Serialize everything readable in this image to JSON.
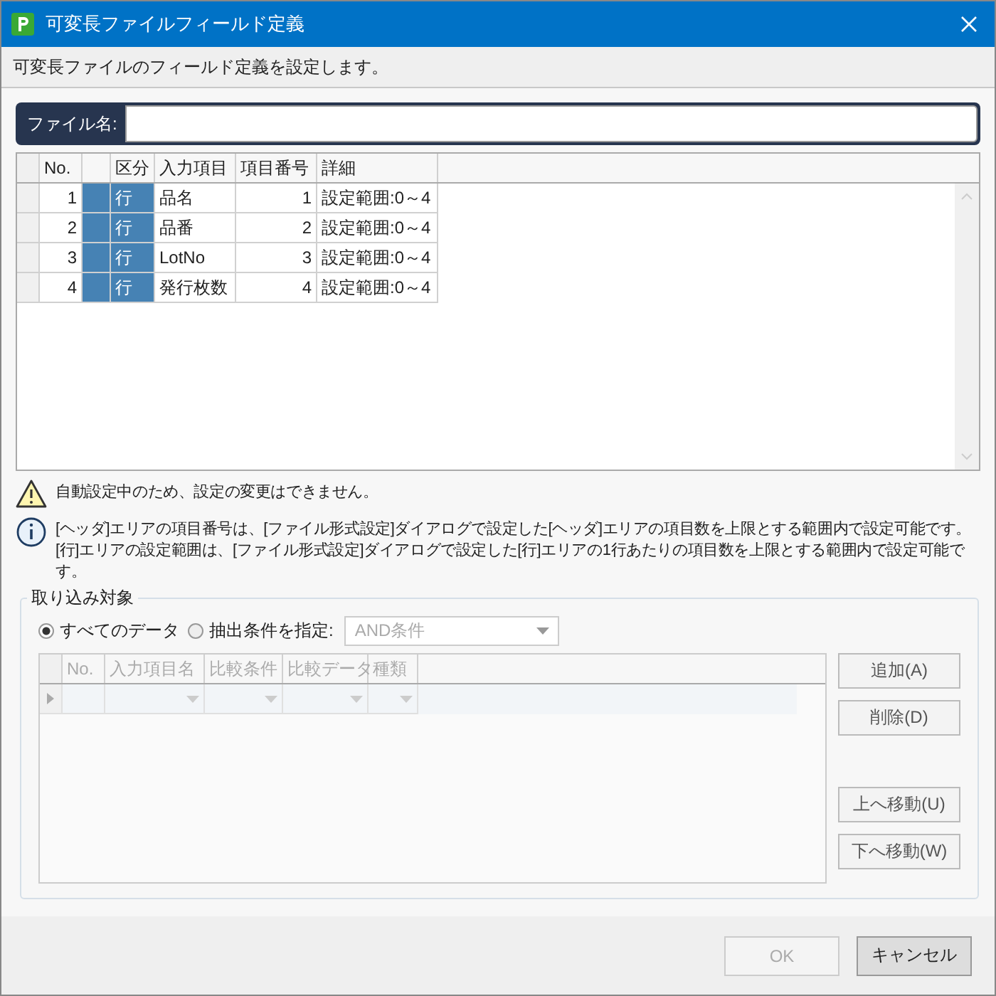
{
  "window": {
    "title": "可変長ファイルフィールド定義"
  },
  "description": "可変長ファイルのフィールド定義を設定します。",
  "file_name": {
    "label": "ファイル名:"
  },
  "fields_table": {
    "columns": [
      "No.",
      "区分",
      "入力項目",
      "項目番号",
      "詳細"
    ],
    "rows": [
      {
        "no": "1",
        "category": "行",
        "item": "品名",
        "item_number": "1",
        "detail": "設定範囲:0～4"
      },
      {
        "no": "2",
        "category": "行",
        "item": "品番",
        "item_number": "2",
        "detail": "設定範囲:0～4"
      },
      {
        "no": "3",
        "category": "行",
        "item": "LotNo",
        "item_number": "3",
        "detail": "設定範囲:0～4"
      },
      {
        "no": "4",
        "category": "行",
        "item": "発行枚数",
        "item_number": "4",
        "detail": "設定範囲:0～4"
      }
    ]
  },
  "messages": [
    {
      "kind": "warning",
      "text": "自動設定中のため、設定の変更はできません。"
    },
    {
      "kind": "info",
      "text": "[ヘッダ]エリアの項目番号は、[ファイル形式設定]ダイアログで設定した[ヘッダ]エリアの項目数を上限とする範囲内で設定可能です。[行]エリアの設定範囲は、[ファイル形式設定]ダイアログで設定した[行]エリアの1行あたりの項目数を上限とする範囲内で設定可能です。"
    }
  ],
  "import_target": {
    "title": "取り込み対象",
    "options": [
      {
        "label": "すべてのデータ",
        "selected": true
      },
      {
        "label": "抽出条件を指定:",
        "selected": false
      }
    ],
    "condition_dropdown": {
      "value": "AND条件",
      "disabled": true
    },
    "conditions_table": {
      "columns": [
        "No.",
        "入力項目名",
        "比較条件",
        "比較データ",
        "種類"
      ],
      "disabled": true
    },
    "buttons": [
      {
        "label": "追加(A)",
        "disabled": false
      },
      {
        "label": "削除(D)",
        "disabled": false
      },
      {
        "label": "上へ移動(U)",
        "disabled": false
      },
      {
        "label": "下へ移動(W)",
        "disabled": false
      }
    ]
  },
  "footer_buttons": [
    {
      "label": "OK",
      "disabled": true
    },
    {
      "label": "キャンセル",
      "disabled": false
    }
  ]
}
